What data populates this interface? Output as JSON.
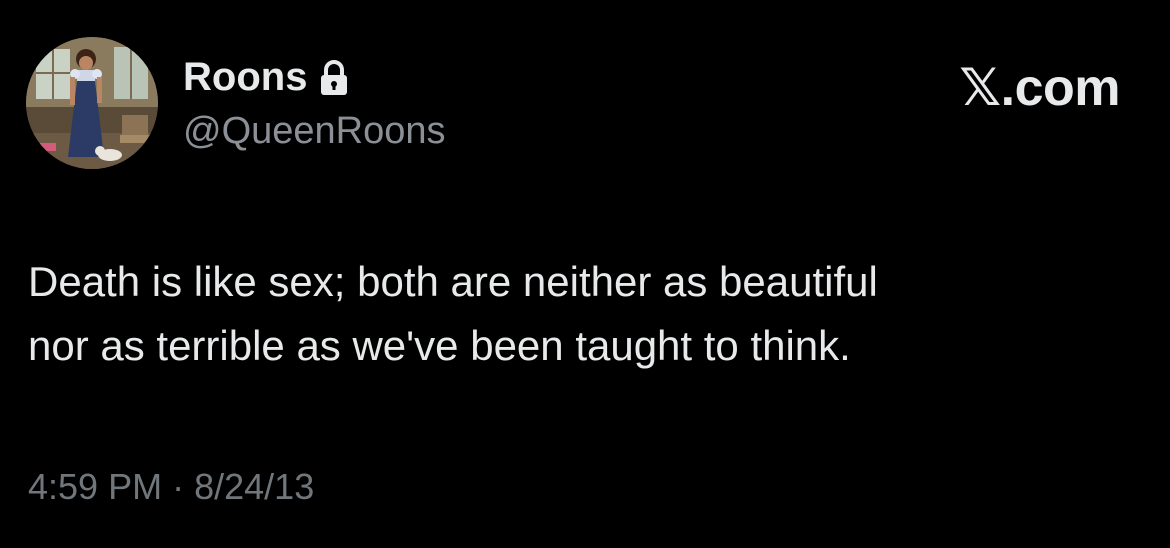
{
  "author": {
    "display_name": "Roons",
    "handle": "@QueenRoons",
    "protected_icon": "lock-icon",
    "avatar": "avatar-image"
  },
  "brand": {
    "label": "𝕏.com"
  },
  "tweet": {
    "text_lines": [
      "Death is like sex; both are neither as beautiful",
      "nor as terrible as we've been taught to think."
    ],
    "time": "4:59 PM",
    "separator": "·",
    "date": "8/24/13"
  },
  "colors": {
    "background": "#000000",
    "primary_text": "#e7e9ea",
    "secondary_text": "#71767b"
  }
}
